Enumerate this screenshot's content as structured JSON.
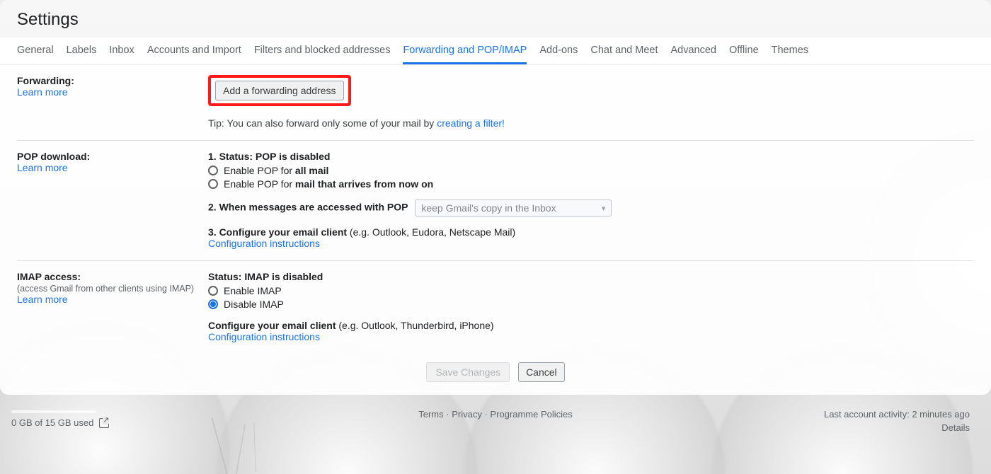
{
  "page_title": "Settings",
  "tabs": [
    {
      "label": "General"
    },
    {
      "label": "Labels"
    },
    {
      "label": "Inbox"
    },
    {
      "label": "Accounts and Import"
    },
    {
      "label": "Filters and blocked addresses"
    },
    {
      "label": "Forwarding and POP/IMAP",
      "active": true
    },
    {
      "label": "Add-ons"
    },
    {
      "label": "Chat and Meet"
    },
    {
      "label": "Advanced"
    },
    {
      "label": "Offline"
    },
    {
      "label": "Themes"
    }
  ],
  "forwarding": {
    "title": "Forwarding:",
    "learn_more": "Learn more",
    "add_button": "Add a forwarding address",
    "tip_prefix": "Tip: You can also forward only some of your mail by ",
    "tip_link": "creating a filter!"
  },
  "pop": {
    "title": "POP download:",
    "learn_more": "Learn more",
    "status_line_prefix": "1. Status: ",
    "status_value": "POP is disabled",
    "opt_all_prefix": "Enable POP for ",
    "opt_all_bold": "all mail",
    "opt_new_prefix": "Enable POP for ",
    "opt_new_bold": "mail that arrives from now on",
    "step2": "2. When messages are accessed with POP",
    "select_value": "keep Gmail's copy in the Inbox",
    "step3_bold": "3. Configure your email client",
    "step3_rest": " (e.g. Outlook, Eudora, Netscape Mail)",
    "config_link": "Configuration instructions"
  },
  "imap": {
    "title": "IMAP access:",
    "subtitle": "(access Gmail from other clients using IMAP)",
    "learn_more": "Learn more",
    "status_prefix": "Status: ",
    "status_value": "IMAP is disabled",
    "opt_enable": "Enable IMAP",
    "opt_disable": "Disable IMAP",
    "conf_bold": "Configure your email client",
    "conf_rest": " (e.g. Outlook, Thunderbird, iPhone)",
    "config_link": "Configuration instructions"
  },
  "actions": {
    "save": "Save Changes",
    "cancel": "Cancel"
  },
  "footer": {
    "storage": "0 GB of 15 GB used",
    "terms": "Terms",
    "privacy": "Privacy",
    "policies": "Programme Policies",
    "activity": "Last account activity: 2 minutes ago",
    "details": "Details"
  }
}
